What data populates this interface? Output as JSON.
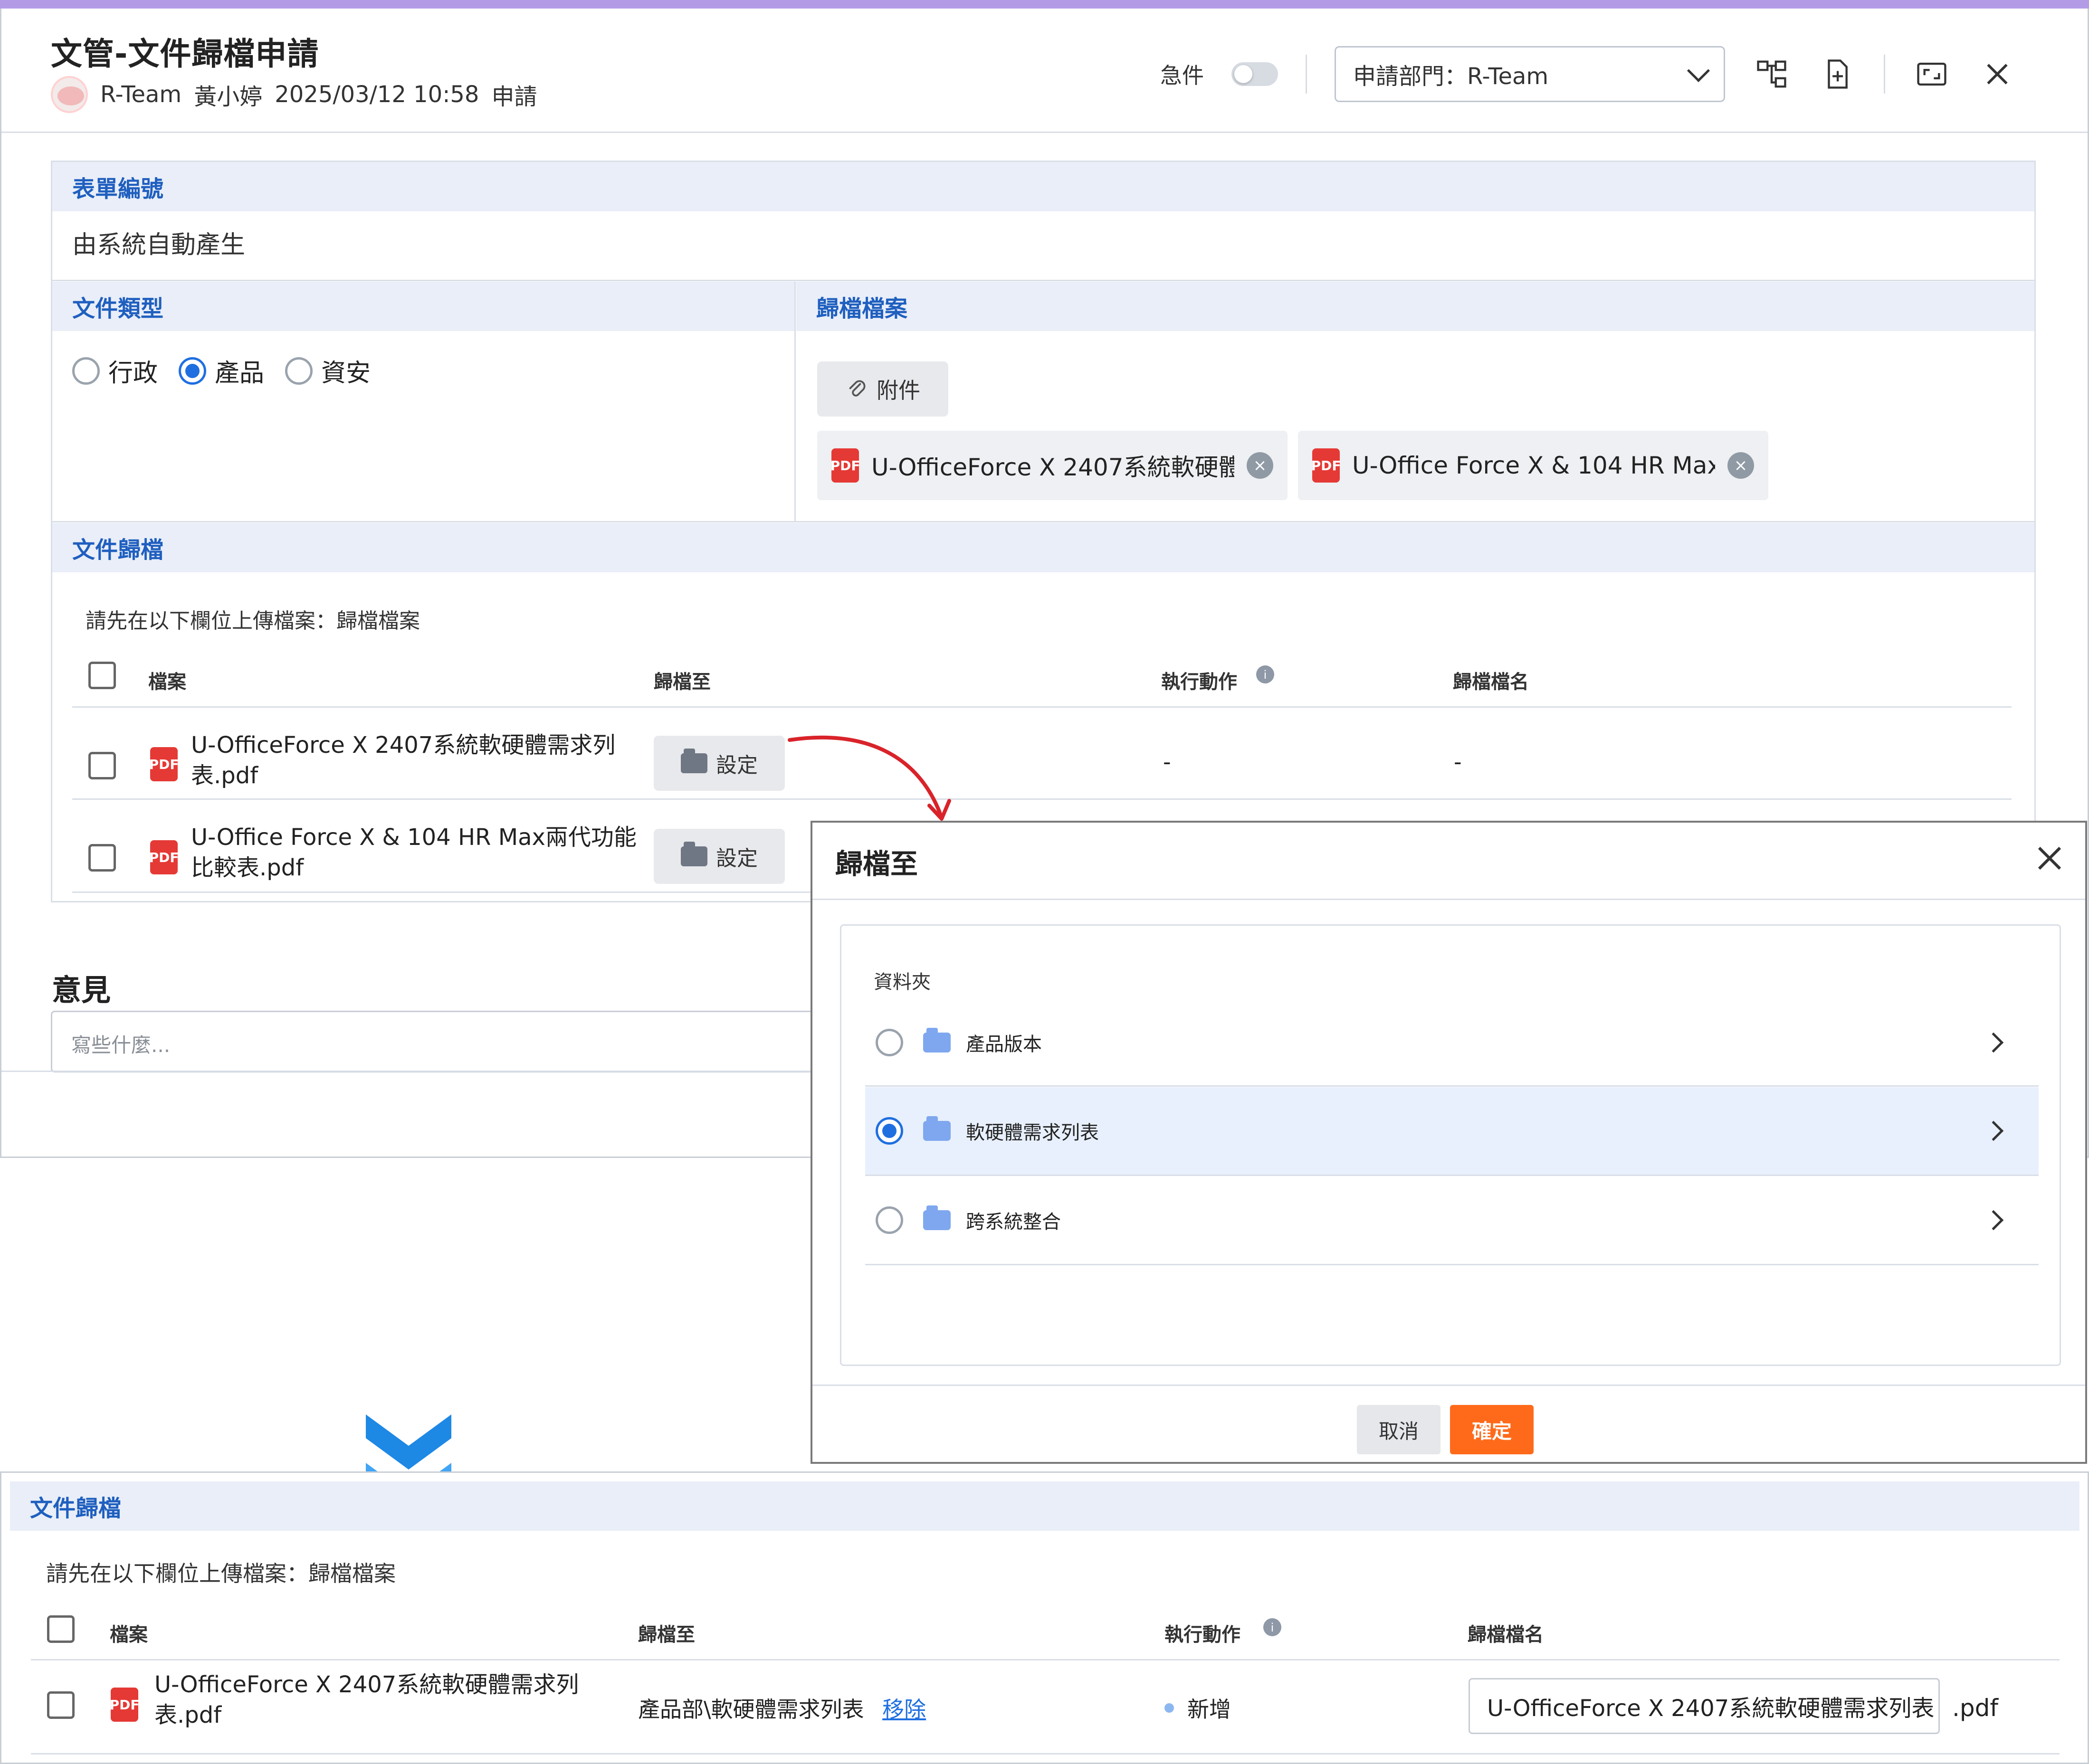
{
  "header": {
    "title": "文管-文件歸檔申請",
    "team": "R-Team",
    "applicant": "黃小婷",
    "datetime": "2025/03/12 10:58",
    "status": "申請",
    "urgent_label": "急件",
    "department_select": "申請部門：R-Team"
  },
  "form": {
    "form_number_label": "表單編號",
    "form_number_value": "由系統自動產生",
    "doc_type_label": "文件類型",
    "doc_types": [
      "行政",
      "產品",
      "資安"
    ],
    "doc_type_selected": "產品",
    "archive_file_label": "歸檔檔案",
    "attach_button": "附件",
    "attached_files": [
      "U-OfficeForce X 2407系統軟硬體...",
      "U-Office Force X & 104 HR Max..."
    ],
    "doc_archive_label": "文件歸檔",
    "upload_hint": "請先在以下欄位上傳檔案：歸檔檔案",
    "table_headers": [
      "檔案",
      "歸檔至",
      "執行動作",
      "歸檔檔名"
    ],
    "rows": [
      {
        "file_line1": "U-OfficeForce X 2407系統軟硬體需求列",
        "file_line2": "表.pdf",
        "button": "設定",
        "action": "-",
        "name": "-"
      },
      {
        "file_line1": "U-Office Force X & 104 HR Max兩代功能",
        "file_line2": "比較表.pdf",
        "button": "設定",
        "action": "",
        "name": ""
      }
    ]
  },
  "opinion": {
    "title": "意見",
    "placeholder": "寫些什麼..."
  },
  "dialog": {
    "title": "歸檔至",
    "folder_label": "資料夾",
    "folders": [
      "產品版本",
      "軟硬體需求列表",
      "跨系統整合"
    ],
    "selected_folder": "軟硬體需求列表",
    "cancel": "取消",
    "confirm": "確定"
  },
  "result": {
    "section_label": "文件歸檔",
    "upload_hint": "請先在以下欄位上傳檔案：歸檔檔案",
    "table_headers": [
      "檔案",
      "歸檔至",
      "執行動作",
      "歸檔檔名"
    ],
    "row": {
      "file_line1": "U-OfficeForce X 2407系統軟硬體需求列",
      "file_line2": "表.pdf",
      "target": "產品部\\軟硬體需求列表",
      "remove_link": "移除",
      "action": "新增",
      "filename": "U-OfficeForce X 2407系統軟硬體需求列表",
      "extension": ".pdf"
    }
  },
  "colors": {
    "accent_blue": "#1f5fbf",
    "confirm_orange": "#ff6a1a",
    "section_bg": "#e9eef8",
    "top_accent": "#b49be6"
  },
  "icons": [
    "org-chart-icon",
    "add-document-icon",
    "maximize-icon",
    "close-icon",
    "paperclip-icon",
    "pdf-icon",
    "folder-icon",
    "info-icon",
    "chevron-right-icon",
    "chevron-down-icon"
  ]
}
